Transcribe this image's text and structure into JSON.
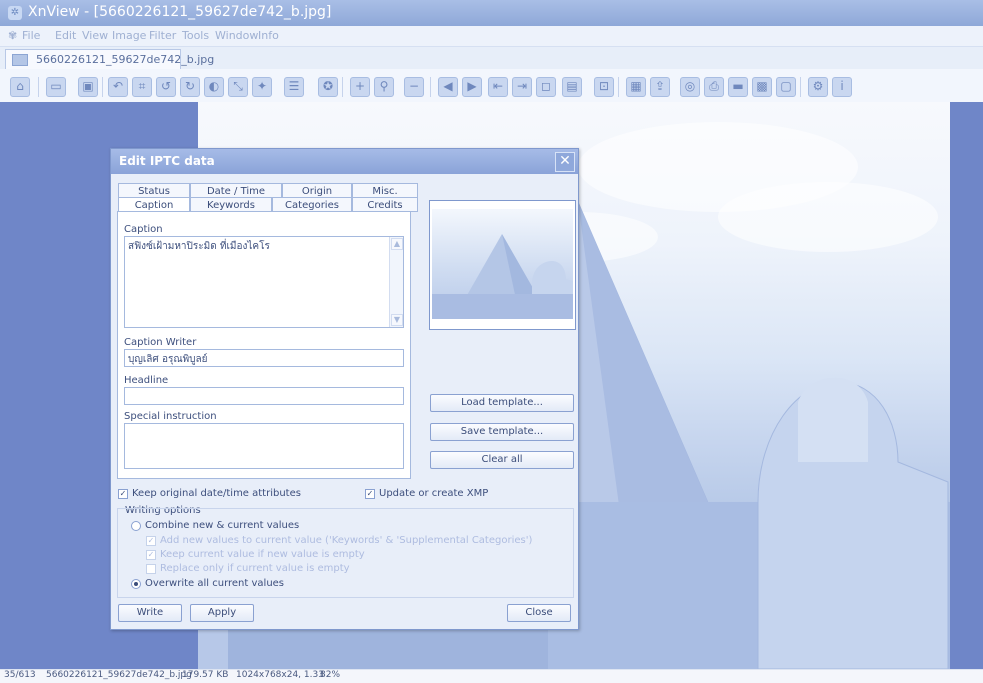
{
  "window": {
    "title": "XnView - [5660226121_59627de742_b.jpg]"
  },
  "menu": [
    "File",
    "Edit",
    "View",
    "Image",
    "Filter",
    "Tools",
    "Window",
    "Info"
  ],
  "tab": {
    "label": "5660226121_59627de742_b.jpg"
  },
  "toolbar": {
    "icons": [
      "browser-icon",
      "open-folder-icon",
      "save-icon",
      "undo-icon",
      "crop-icon",
      "rotate-left-icon",
      "rotate-right-icon",
      "adjust-icon",
      "resize-icon",
      "effects-icon",
      "print-list-icon",
      "award-icon",
      "zoom-in-icon",
      "zoom-dropdown-icon",
      "zoom-out-icon",
      "prev-icon",
      "next-icon",
      "first-icon",
      "last-icon",
      "fullscreen-icon",
      "slideshow-icon",
      "lock-icon",
      "thumbnail-icon",
      "export-icon",
      "find-icon",
      "print-icon",
      "scanner-icon",
      "gallery-icon",
      "capture-icon",
      "settings-icon",
      "info-icon"
    ]
  },
  "dialog": {
    "title": "Edit IPTC data",
    "tabs_row1": [
      "Status",
      "Date / Time",
      "Origin",
      "Misc."
    ],
    "tabs_row2": [
      "Caption",
      "Keywords",
      "Categories",
      "Credits"
    ],
    "active_tab": "Caption",
    "caption_label": "Caption",
    "caption_value": "สฟิงซ์เฝ้ามหาปิระมิด ที่เมืองไคโร",
    "caption_writer_label": "Caption Writer",
    "caption_writer_value": "บุญเลิศ อรุณพิบูลย์",
    "headline_label": "Headline",
    "headline_value": "",
    "special_instruction_label": "Special instruction",
    "special_instruction_value": "",
    "load_template": "Load template...",
    "save_template": "Save template...",
    "clear_all": "Clear all",
    "keep_date_label": "Keep original date/time attributes",
    "keep_date_checked": true,
    "update_xmp_label": "Update or create XMP",
    "update_xmp_checked": true,
    "writing_options_label": "Writing options",
    "combine_label": "Combine new & current values",
    "add_new_label": "Add new values to current value ('Keywords' & 'Supplemental Categories')",
    "keep_current_label": "Keep current value if new value is empty",
    "replace_only_label": "Replace only if current value is empty",
    "overwrite_label": "Overwrite all current values",
    "selected_option": "overwrite",
    "write_button": "Write",
    "apply_button": "Apply",
    "close_button": "Close"
  },
  "status": {
    "index": "35/613",
    "filename": "5660226121_59627de742_b.jpg",
    "size": "179.57 KB",
    "dims": "1024x768x24, 1.33",
    "zoom": "82%"
  }
}
